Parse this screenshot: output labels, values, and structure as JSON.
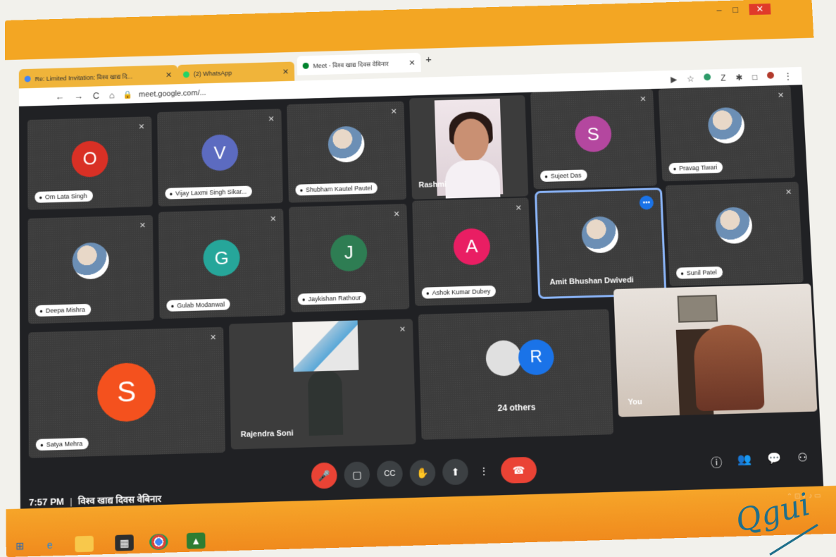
{
  "browser": {
    "tabs": [
      {
        "label": "Re: Limited Invitation: विश्व खाद्य दि...",
        "favicon_color": "#4285f4"
      },
      {
        "label": "(2) WhatsApp",
        "favicon_color": "#25d366"
      },
      {
        "label": "Meet - विश्व खाद्य दिवस वेबिनार",
        "favicon_color": "#00832d"
      }
    ],
    "new_tab": "+",
    "address": "meet.google.com/...",
    "nav": {
      "back": "←",
      "forward": "→",
      "reload": "C",
      "home": "⌂"
    },
    "window_controls": {
      "minimize": "–",
      "maximize": "□",
      "close": "✕"
    }
  },
  "meet": {
    "tiles": [
      {
        "name": "Om Lata Singh",
        "initial": "O",
        "color": "#d93025",
        "type": "letter"
      },
      {
        "name": "Vijay Laxmi Singh Sikar...",
        "initial": "V",
        "color": "#5c6bc0",
        "type": "letter"
      },
      {
        "name": "Shubham Kautel Pautel",
        "type": "photo"
      },
      {
        "name": "Rashmi",
        "type": "video"
      },
      {
        "name": "Sujeet Das",
        "initial": "S",
        "color": "#b4479f",
        "type": "letter"
      },
      {
        "name": "Pravag Tiwari",
        "type": "photo"
      },
      {
        "name": "Deepa Mishra",
        "type": "photo"
      },
      {
        "name": "Gulab Modanwal",
        "initial": "G",
        "color": "#26a69a",
        "type": "letter"
      },
      {
        "name": "Jaykishan Rathour",
        "initial": "J",
        "color": "#2e7d53",
        "type": "letter"
      },
      {
        "name": "Ashok Kumar Dubey",
        "initial": "A",
        "color": "#e91e63",
        "type": "letter"
      },
      {
        "name": "Amit Bhushan Dwivedi",
        "type": "photo-active"
      },
      {
        "name": "Sunil Patel",
        "type": "photo"
      },
      {
        "name": "Satya Mehra",
        "initial": "S",
        "color": "#f4511e",
        "type": "letter-big"
      },
      {
        "name": "Rajendra Soni",
        "type": "video"
      },
      {
        "name": "24 others",
        "initial": "R",
        "color": "#1a73e8",
        "type": "others"
      },
      {
        "name": "You",
        "type": "video-self"
      }
    ],
    "more_options": "•••"
  },
  "bottom_bar": {
    "time": "7:57 PM",
    "separator": "|",
    "meeting_title": "विश्व खाद्य दिवस वेबिनार",
    "controls": [
      {
        "name": "mic",
        "glyph": "🎤"
      },
      {
        "name": "camera",
        "glyph": "▢"
      },
      {
        "name": "captions",
        "glyph": "CC"
      },
      {
        "name": "raise-hand",
        "glyph": "✋"
      },
      {
        "name": "present",
        "glyph": "⬆"
      },
      {
        "name": "more",
        "glyph": "⋮"
      },
      {
        "name": "end-call",
        "glyph": "☎"
      }
    ],
    "right_controls": [
      {
        "name": "info",
        "glyph": "ⓘ"
      },
      {
        "name": "people",
        "glyph": "👥"
      },
      {
        "name": "chat",
        "glyph": "💬"
      },
      {
        "name": "activities",
        "glyph": "⚇"
      }
    ]
  },
  "taskbar": {
    "icons": [
      "start",
      "ie",
      "file-explorer",
      "store",
      "chrome",
      "app"
    ]
  }
}
